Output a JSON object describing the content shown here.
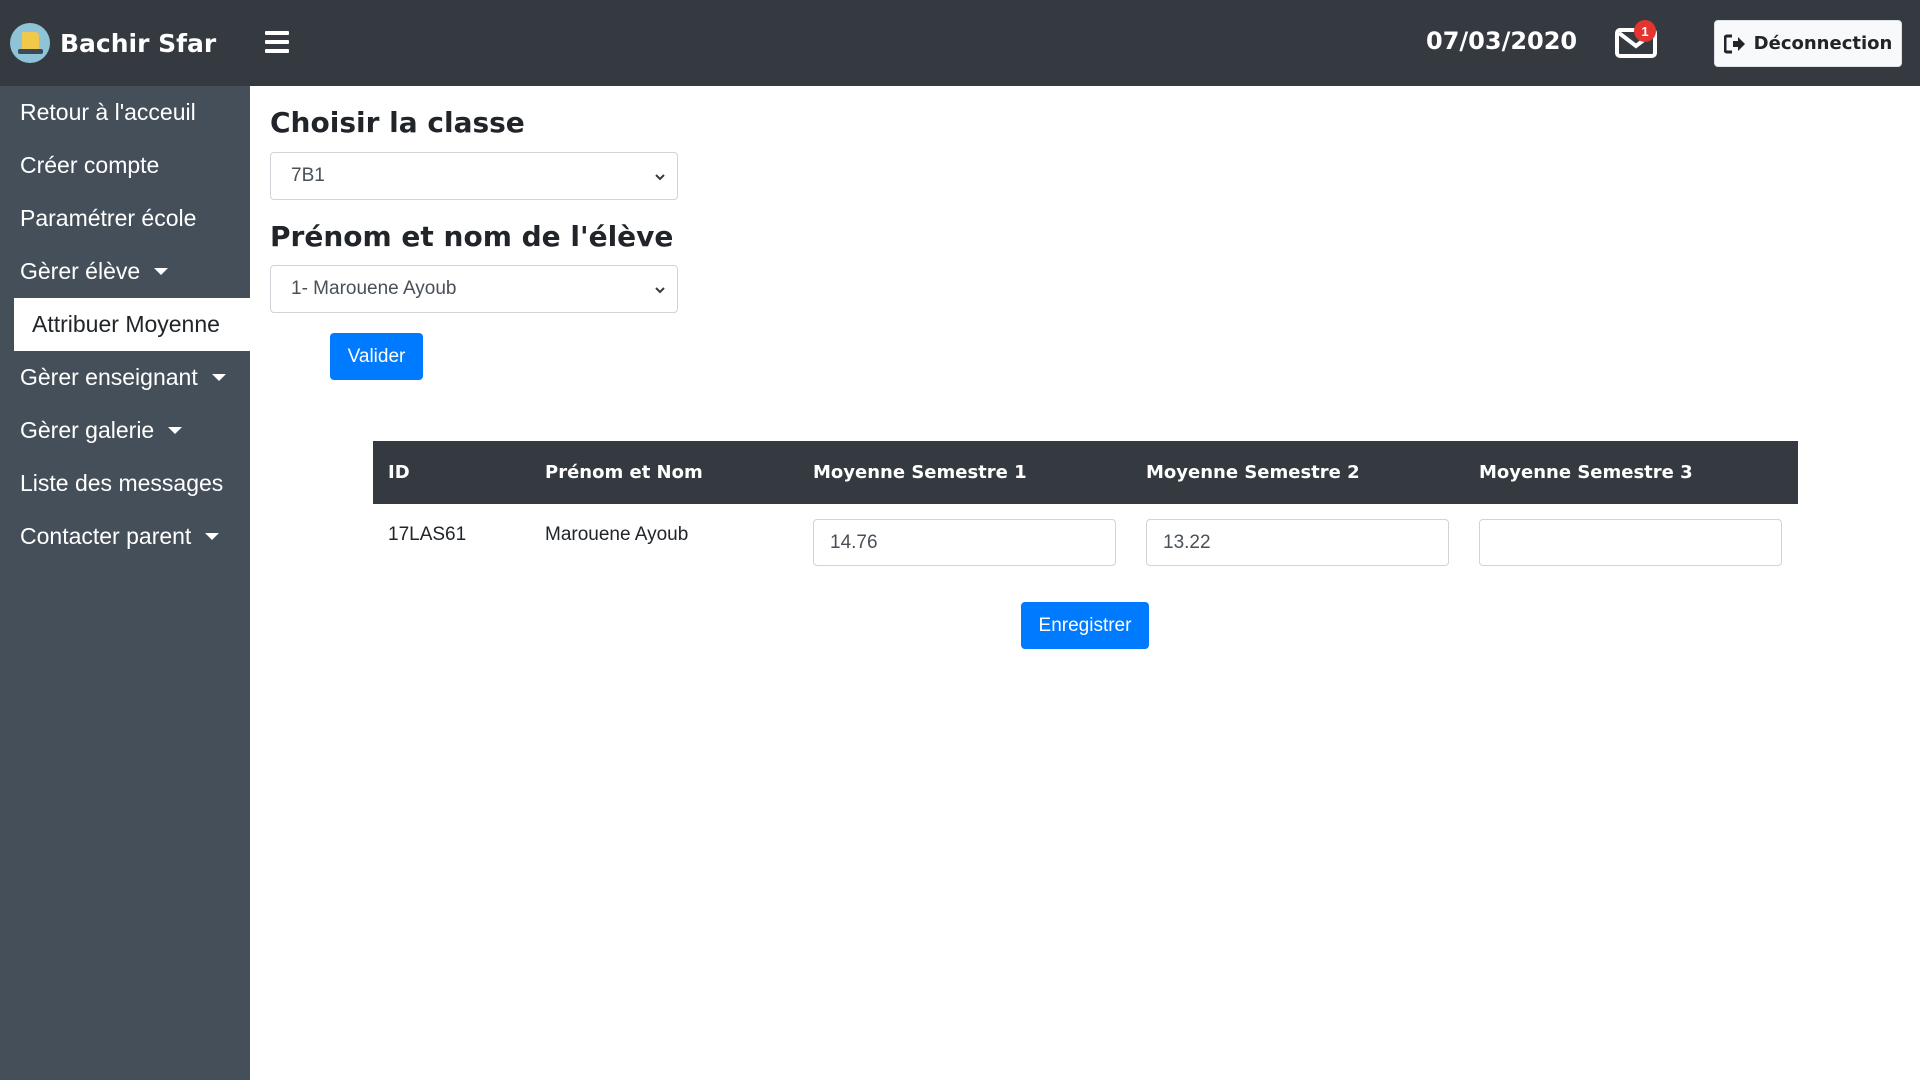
{
  "topbar": {
    "brand_name": "Bachir Sfar",
    "date": "07/03/2020",
    "mail_badge": "1",
    "logout_label": "Déconnection"
  },
  "sidebar": {
    "items": [
      {
        "label": "Retour à l'acceuil",
        "has_caret": false,
        "active": false
      },
      {
        "label": "Créer compte",
        "has_caret": false,
        "active": false
      },
      {
        "label": "Paramétrer école",
        "has_caret": false,
        "active": false
      },
      {
        "label": "Gèrer élève",
        "has_caret": true,
        "active": false
      },
      {
        "label": "Attribuer Moyenne",
        "has_caret": false,
        "active": true
      },
      {
        "label": "Gèrer enseignant",
        "has_caret": true,
        "active": false
      },
      {
        "label": "Gèrer galerie",
        "has_caret": true,
        "active": false
      },
      {
        "label": "Liste des messages",
        "has_caret": false,
        "active": false
      },
      {
        "label": "Contacter parent",
        "has_caret": true,
        "active": false
      }
    ]
  },
  "form": {
    "class_heading": "Choisir la classe",
    "class_value": "7B1",
    "student_heading": "Prénom et nom de l'élève",
    "student_value": "1- Marouene Ayoub",
    "validate_label": "Valider"
  },
  "table": {
    "headers": [
      "ID",
      "Prénom et Nom",
      "Moyenne Semestre 1",
      "Moyenne Semestre 2",
      "Moyenne Semestre 3"
    ],
    "rows": [
      {
        "id": "17LAS61",
        "name": "Marouene Ayoub",
        "s1": "14.76",
        "s2": "13.22",
        "s3": ""
      }
    ]
  },
  "save_label": "Enregistrer",
  "colors": {
    "topbar": "#343a40",
    "sidebar": "#454f5a",
    "primary": "#007bff",
    "badge": "#e3342f"
  },
  "icons": {
    "brand": "book-logo-icon",
    "menu": "hamburger-icon",
    "mail": "envelope-icon",
    "logout": "sign-out-icon",
    "select": "chevron-down-icon"
  }
}
